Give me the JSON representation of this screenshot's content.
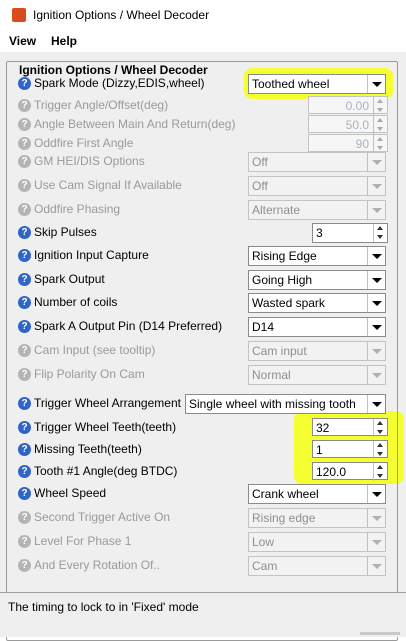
{
  "window": {
    "title": "Ignition Options / Wheel Decoder"
  },
  "menu": {
    "view": "View",
    "help": "Help"
  },
  "group_title": "Ignition Options / Wheel Decoder",
  "rows": {
    "spark_mode": {
      "label": "Spark Mode (Dizzy,EDIS,wheel)",
      "value": "Toothed wheel"
    },
    "trigger_angle": {
      "label": "Trigger Angle/Offset(deg)",
      "value": "0.00"
    },
    "angle_between": {
      "label": "Angle Between Main And Return(deg)",
      "value": "50.0"
    },
    "oddfire_first": {
      "label": "Oddfire First Angle",
      "value": "90"
    },
    "gm_hei": {
      "label": "GM HEI/DIS Options",
      "value": "Off"
    },
    "use_cam": {
      "label": "Use Cam Signal If Available",
      "value": "Off"
    },
    "oddfire_phasing": {
      "label": "Oddfire Phasing",
      "value": "Alternate"
    },
    "skip_pulses": {
      "label": "Skip Pulses",
      "value": "3"
    },
    "ign_input": {
      "label": "Ignition Input Capture",
      "value": "Rising Edge"
    },
    "spark_output": {
      "label": "Spark Output",
      "value": "Going High"
    },
    "num_coils": {
      "label": "Number of coils",
      "value": "Wasted spark"
    },
    "spark_pin": {
      "label": "Spark A Output Pin (D14 Preferred)",
      "value": "D14"
    },
    "cam_input": {
      "label": "Cam Input (see tooltip)",
      "value": "Cam input"
    },
    "flip_polarity": {
      "label": "Flip Polarity On Cam",
      "value": "Normal"
    },
    "wheel_arrangement": {
      "label": "Trigger Wheel Arrangement",
      "value": "Single wheel with missing tooth"
    },
    "wheel_teeth": {
      "label": "Trigger Wheel Teeth(teeth)",
      "value": "32"
    },
    "missing_teeth": {
      "label": "Missing Teeth(teeth)",
      "value": "1"
    },
    "tooth1_angle": {
      "label": "Tooth #1 Angle(deg BTDC)",
      "value": "120.0"
    },
    "wheel_speed": {
      "label": "Wheel Speed",
      "value": "Crank wheel"
    },
    "second_trigger": {
      "label": "Second Trigger Active On",
      "value": "Rising edge"
    },
    "level_phase": {
      "label": "Level For Phase 1",
      "value": "Low"
    },
    "every_rotation": {
      "label": "And Every Rotation Of..",
      "value": "Cam"
    }
  },
  "help_glyph": "?",
  "status": {
    "message": "The timing to lock to in 'Fixed' mode"
  },
  "colors": {
    "highlight": "#f4ff1c",
    "help_icon": "#2f64c8",
    "disabled_text": "#9a9a9a"
  }
}
